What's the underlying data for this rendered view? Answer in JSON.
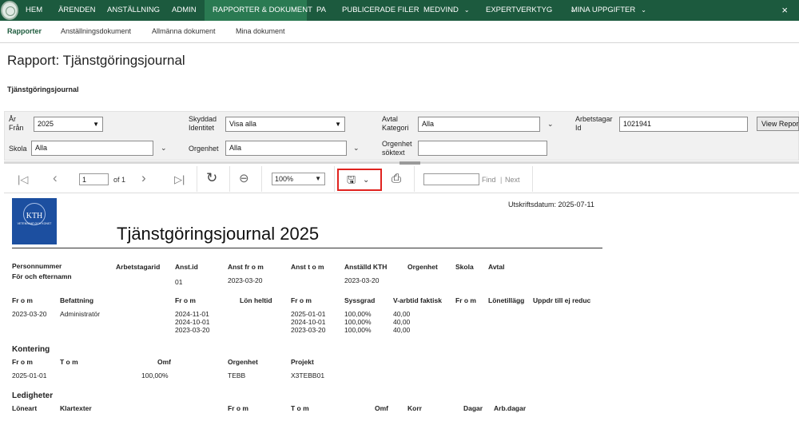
{
  "nav": {
    "home": "HEM",
    "items": [
      {
        "label": "ÄRENDEN",
        "chevron": false
      },
      {
        "label": "ANSTÄLLNING",
        "chevron": false
      },
      {
        "label": "ADMIN",
        "chevron": false
      },
      {
        "label": "RAPPORTER & DOKUMENT",
        "chevron": false,
        "active": true
      },
      {
        "label": "PA",
        "chevron": false
      },
      {
        "label": "PUBLICERADE FILER",
        "chevron": false
      },
      {
        "label": "MEDVIND",
        "chevron": true
      },
      {
        "label": "EXPERTVERKTYG",
        "chevron": true
      },
      {
        "label": "MINA UPPGIFTER",
        "chevron": true
      }
    ],
    "close": "×"
  },
  "subnav": [
    "Rapporter",
    "Anställningsdokument",
    "Allmänna dokument",
    "Mina dokument"
  ],
  "page_title": "Rapport: Tjänstgöringsjournal",
  "section_label": "Tjänstgöringsjournal",
  "params": {
    "year_label": "År",
    "from_label": "Från",
    "year_value": "2025",
    "skola_label": "Skola",
    "skola_value": "Alla",
    "skyddad_label_1": "Skyddad",
    "skyddad_label_2": "Identitet",
    "skyddad_value": "Visa alla",
    "orgenhet_label": "Orgenhet",
    "orgenhet_value": "Alla",
    "avtal_label_1": "Avtal",
    "avtal_label_2": "Kategori",
    "avtal_value": "Alla",
    "orgenhet_sok_label_1": "Orgenhet",
    "orgenhet_sok_label_2": "söktext",
    "orgenhet_sok_value": "",
    "arbetstagar_label_1": "Arbetstagar",
    "arbetstagar_label_2": "Id",
    "arbetstagar_value": "1021941",
    "view_report": "View Report"
  },
  "toolbar": {
    "page_value": "1",
    "of_text": "of 1",
    "zoom": "100%",
    "find_value": "",
    "find_label": "Find",
    "sep": "|",
    "next_label": "Next"
  },
  "report": {
    "print_date": "Utskriftsdatum: 2025-07-11",
    "title": "Tjänstgöringsjournal 2025",
    "logo_text": "KTH",
    "logo_subtext": "VETENSKAP OCH KONST",
    "header1": {
      "personnummer": "Personnummer",
      "for_efternamn": "För och efternamn",
      "arbetstagarid": "Arbetstagarid",
      "anst_id": "Anst.id",
      "anst_from": "Anst fr o m",
      "anst_tom": "Anst t o m",
      "anstalld_kth": "Anställd KTH",
      "orgenhet": "Orgenhet",
      "skola": "Skola",
      "avtal": "Avtal"
    },
    "row1": {
      "anst_id": "01",
      "anst_from": "2023-03-20",
      "anstalld_kth": "2023-03-20"
    },
    "header2": {
      "from1": "Fr o m",
      "befattning": "Befattning",
      "from2": "Fr o m",
      "lon_heltid": "Lön heltid",
      "from3": "Fr o m",
      "syssgrad": "Syssgrad",
      "varbtid": "V-arbtid faktisk",
      "from4": "Fr o m",
      "lonetillagg": "Lönetillägg",
      "uppdr": "Uppdr till ej reduc"
    },
    "befattning_row": {
      "from": "2023-03-20",
      "befattning": "Administratör"
    },
    "lon_from": [
      "2024-11-01",
      "2024-10-01",
      "2023-03-20"
    ],
    "syss_from": [
      "2025-01-01",
      "2024-10-01",
      "2023-03-20"
    ],
    "syssgrad": [
      "100,00%",
      "100,00%",
      "100,00%"
    ],
    "varbtid": [
      "40,00",
      "40,00",
      "40,00"
    ],
    "kontering": {
      "title": "Kontering",
      "h_from": "Fr o m",
      "h_tom": "T o m",
      "h_omf": "Omf",
      "h_orgenhet": "Orgenhet",
      "h_projekt": "Projekt",
      "from": "2025-01-01",
      "omf": "100,00%",
      "orgenhet": "TEBB",
      "projekt": "X3TEBB01"
    },
    "ledigheter": {
      "title": "Ledigheter",
      "h_loneart": "Löneart",
      "h_klartexter": "Klartexter",
      "h_from": "Fr o m",
      "h_tom": "T o m",
      "h_omf": "Omf",
      "h_korr": "Korr",
      "h_dagar": "Dagar",
      "h_arbdagar": "Arb.dagar"
    }
  }
}
